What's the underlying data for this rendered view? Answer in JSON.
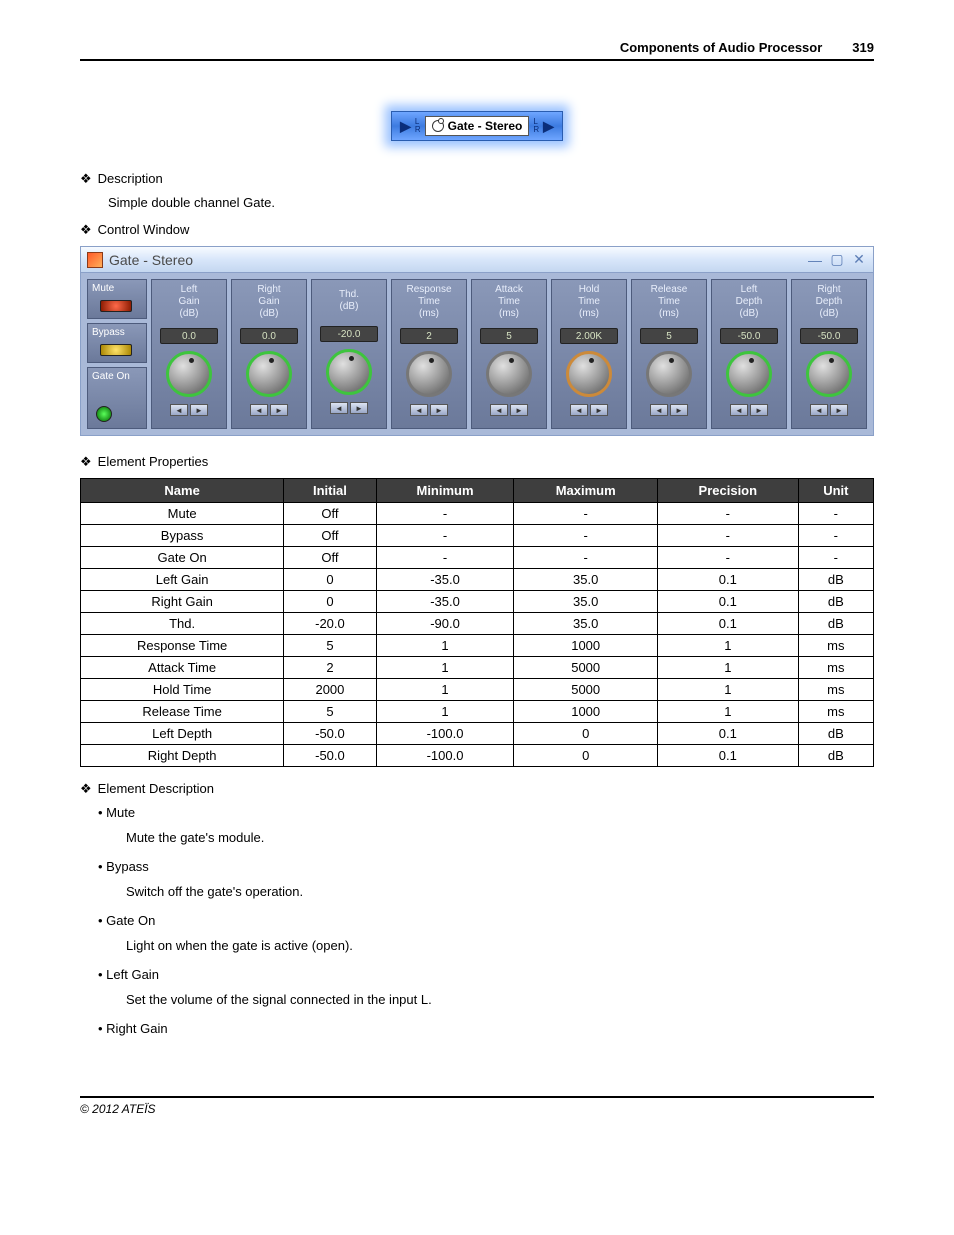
{
  "header": {
    "title": "Components of Audio Processor",
    "page": "319"
  },
  "module_badge": {
    "lr": [
      "L",
      "R"
    ],
    "label": "Gate - Stereo"
  },
  "sections": {
    "description_heading": "Description",
    "description_body": "Simple double channel Gate.",
    "control_window_heading": "Control Window",
    "element_properties_heading": "Element Properties",
    "element_description_heading": "Element Description"
  },
  "control_window": {
    "title": "Gate - Stereo",
    "side_buttons": [
      {
        "label": "Mute",
        "lamp": "red"
      },
      {
        "label": "Bypass",
        "lamp": "yellow"
      },
      {
        "label": "Gate On",
        "lamp": "green"
      }
    ],
    "knobs": [
      {
        "label": "Left\nGain\n(dB)",
        "value": "0.0",
        "ring": "green"
      },
      {
        "label": "Right\nGain\n(dB)",
        "value": "0.0",
        "ring": "green"
      },
      {
        "label": "Thd.\n(dB)",
        "value": "-20.0",
        "ring": "green"
      },
      {
        "label": "Response\nTime\n(ms)",
        "value": "2",
        "ring": "gray"
      },
      {
        "label": "Attack\nTime\n(ms)",
        "value": "5",
        "ring": "gray"
      },
      {
        "label": "Hold\nTime\n(ms)",
        "value": "2.00K",
        "ring": "orange"
      },
      {
        "label": "Release\nTime\n(ms)",
        "value": "5",
        "ring": "gray"
      },
      {
        "label": "Left\nDepth\n(dB)",
        "value": "-50.0",
        "ring": "green"
      },
      {
        "label": "Right\nDepth\n(dB)",
        "value": "-50.0",
        "ring": "green"
      }
    ]
  },
  "properties_table": {
    "headers": [
      "Name",
      "Initial",
      "Minimum",
      "Maximum",
      "Precision",
      "Unit"
    ],
    "rows": [
      [
        "Mute",
        "Off",
        "-",
        "-",
        "-",
        "-"
      ],
      [
        "Bypass",
        "Off",
        "-",
        "-",
        "-",
        "-"
      ],
      [
        "Gate On",
        "Off",
        "-",
        "-",
        "-",
        "-"
      ],
      [
        "Left Gain",
        "0",
        "-35.0",
        "35.0",
        "0.1",
        "dB"
      ],
      [
        "Right Gain",
        "0",
        "-35.0",
        "35.0",
        "0.1",
        "dB"
      ],
      [
        "Thd.",
        "-20.0",
        "-90.0",
        "35.0",
        "0.1",
        "dB"
      ],
      [
        "Response Time",
        "5",
        "1",
        "1000",
        "1",
        "ms"
      ],
      [
        "Attack Time",
        "2",
        "1",
        "5000",
        "1",
        "ms"
      ],
      [
        "Hold Time",
        "2000",
        "1",
        "5000",
        "1",
        "ms"
      ],
      [
        "Release Time",
        "5",
        "1",
        "1000",
        "1",
        "ms"
      ],
      [
        "Left Depth",
        "-50.0",
        "-100.0",
        "0",
        "0.1",
        "dB"
      ],
      [
        "Right Depth",
        "-50.0",
        "-100.0",
        "0",
        "0.1",
        "dB"
      ]
    ]
  },
  "element_descriptions": [
    {
      "name": "Mute",
      "desc": "Mute the gate's module."
    },
    {
      "name": "Bypass",
      "desc": "Switch off the gate's operation."
    },
    {
      "name": "Gate On",
      "desc": "Light on when the gate is active (open)."
    },
    {
      "name": "Left Gain",
      "desc": "Set the volume of the signal connected in the input L."
    },
    {
      "name": "Right Gain",
      "desc": ""
    }
  ],
  "footer": "© 2012 ATEÏS"
}
